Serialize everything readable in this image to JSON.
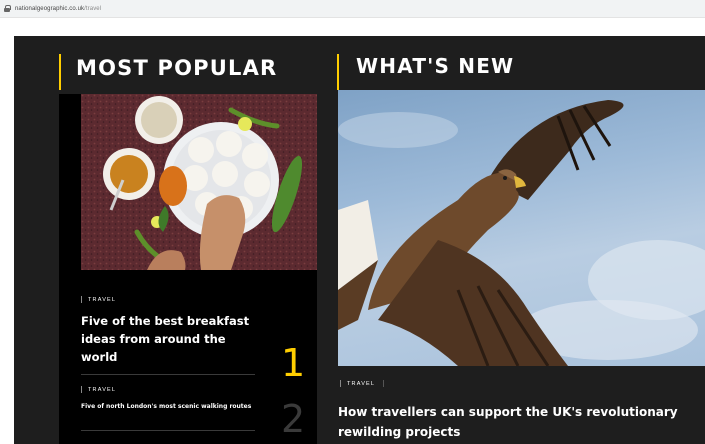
{
  "browser": {
    "url_domain": "nationalgeographic.co.uk",
    "url_path": "/travel"
  },
  "most_popular": {
    "heading": "MOST POPULAR",
    "items": [
      {
        "tag": "TRAVEL",
        "title": "Five of the best breakfast ideas from around the world",
        "rank": "1"
      },
      {
        "tag": "TRAVEL",
        "title": "Five of north London's most scenic walking routes",
        "rank": "2"
      }
    ]
  },
  "whats_new": {
    "heading": "WHAT'S NEW",
    "tag": "TRAVEL",
    "title": "How travellers can support the UK's revolutionary rewilding projects"
  },
  "colors": {
    "accent": "#ffce00",
    "background": "#1e1e1e",
    "panel": "#000000"
  }
}
